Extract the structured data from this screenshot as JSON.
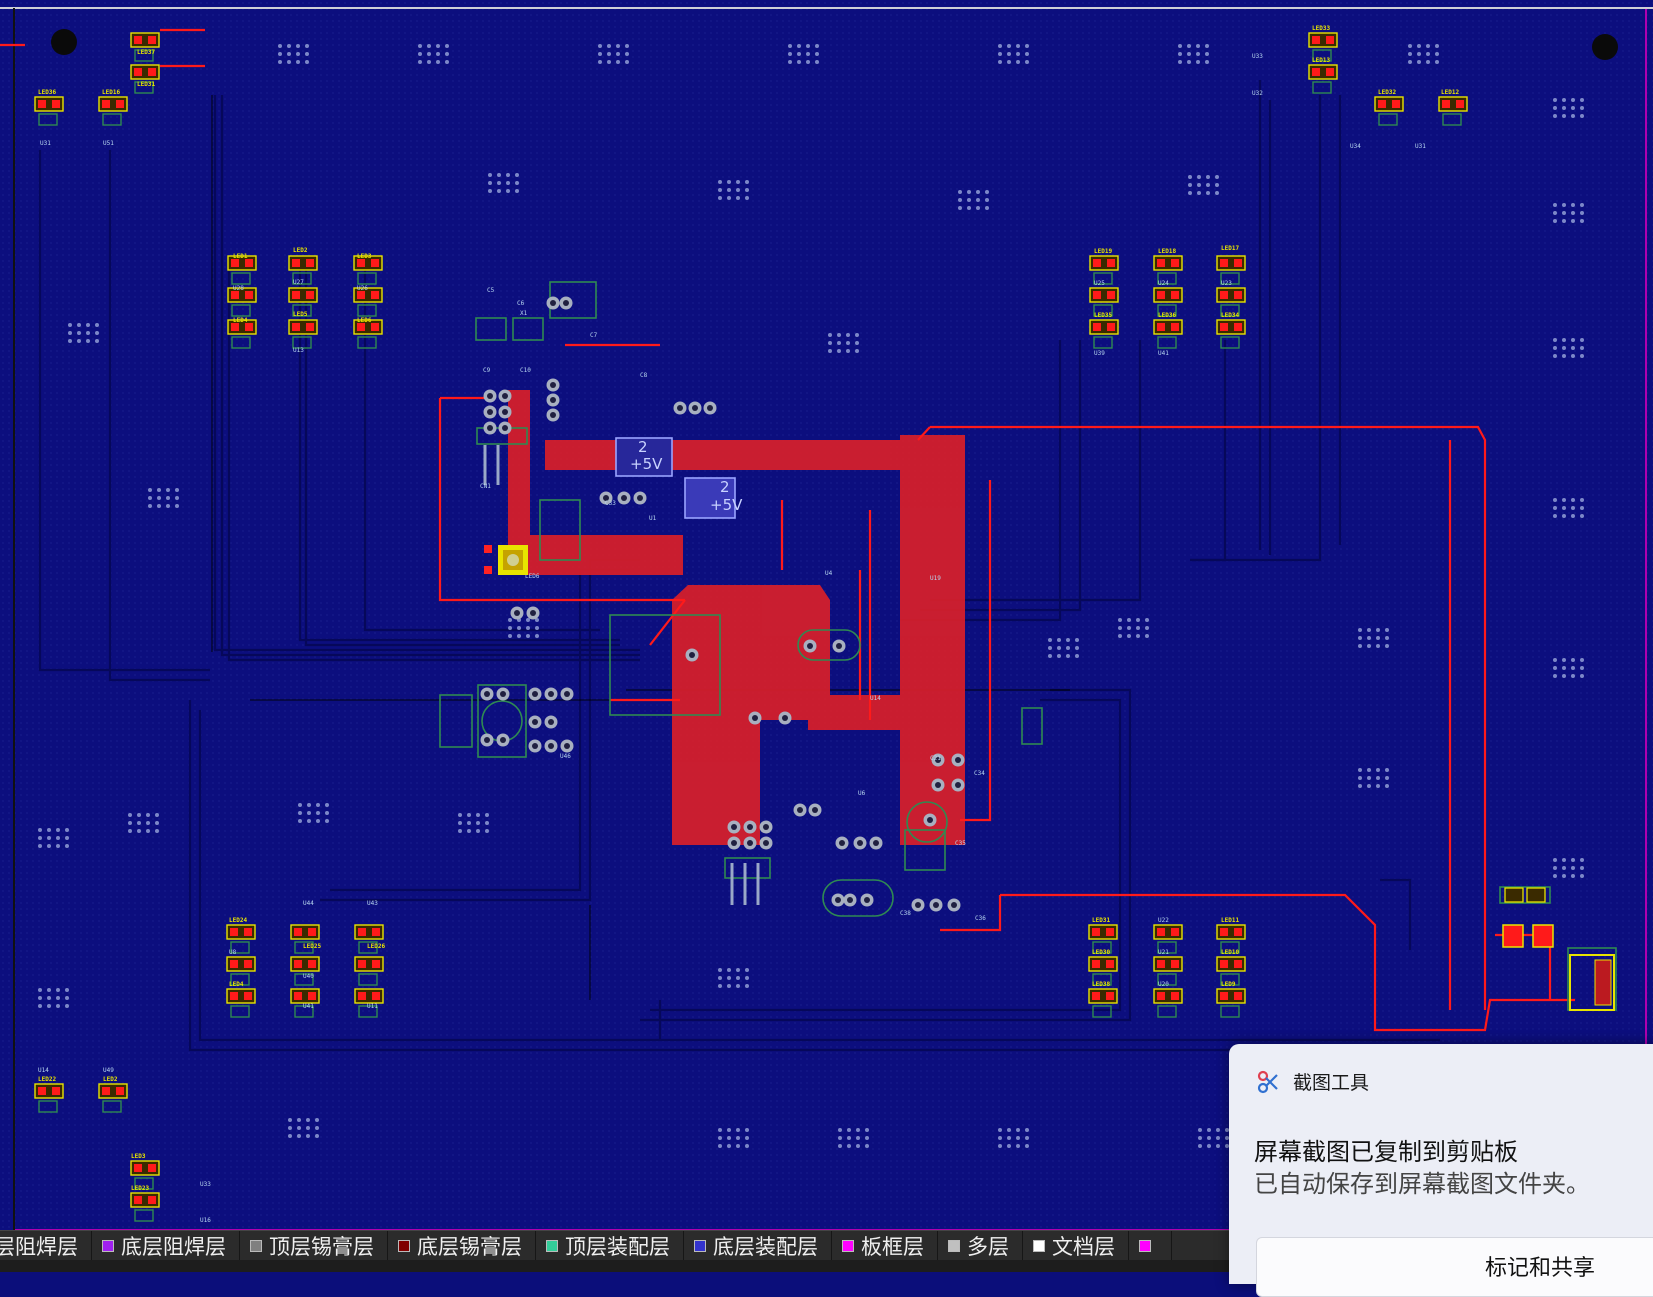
{
  "board": {
    "designators": {
      "top_left": [
        "LED37",
        "LED31",
        "LED36",
        "LED16",
        "U31",
        "U51"
      ],
      "left_block": [
        "LED1",
        "LED2",
        "LED3",
        "U28",
        "U27",
        "U26",
        "LED4",
        "LED5",
        "LED6",
        "U13"
      ],
      "right_block": [
        "LED19",
        "LED18",
        "LED17",
        "U25",
        "U24",
        "U23",
        "LED35",
        "LED36",
        "LED34",
        "U39",
        "U41"
      ],
      "top_right": [
        "LED33",
        "LED13",
        "LED32",
        "LED12",
        "U33",
        "U32",
        "U34",
        "U31"
      ],
      "bottom_left": [
        "LED24",
        "U8",
        "LED4",
        "U44",
        "LED25",
        "U40",
        "U41",
        "U43",
        "LED26",
        "U11"
      ],
      "bottom_right": [
        "LED31",
        "U22",
        "LED11",
        "LED30",
        "U21",
        "LED10",
        "LED38",
        "U20",
        "LED9"
      ],
      "far_bottom_left": [
        "U14",
        "U49",
        "LED22",
        "LED2",
        "LED3",
        "LED23",
        "U33",
        "U16"
      ],
      "center": [
        "C5",
        "C9",
        "C6",
        "C10",
        "C7",
        "C8",
        "C33",
        "C34",
        "C35",
        "C36",
        "C38",
        "CN1",
        "LED6",
        "U1",
        "X1",
        "U4",
        "U6",
        "U46",
        "U19",
        "C21",
        "U14"
      ]
    },
    "power_labels": [
      {
        "num": "2",
        "net": "+5V"
      },
      {
        "num": "2",
        "net": "+5V"
      }
    ]
  },
  "layer_bar": {
    "tabs": [
      {
        "label": "层阻焊层",
        "color": "#1a1a1a"
      },
      {
        "label": "底层阻焊层",
        "color": "#a020f0"
      },
      {
        "label": "顶层锡膏层",
        "color": "#808080"
      },
      {
        "label": "底层锡膏层",
        "color": "#800000"
      },
      {
        "label": "顶层装配层",
        "color": "#33cc99"
      },
      {
        "label": "底层装配层",
        "color": "#3333cc"
      },
      {
        "label": "板框层",
        "color": "#ff00ff"
      },
      {
        "label": "多层",
        "color": "#c0c0c0"
      },
      {
        "label": "文档层",
        "color": "#ffffff"
      },
      {
        "label": "",
        "color": "#ff00ff"
      }
    ]
  },
  "toast": {
    "app_name": "截图工具",
    "title": "屏幕截图已复制到剪贴板",
    "body": "已自动保存到屏幕截图文件夹。",
    "action": "标记和共享"
  }
}
